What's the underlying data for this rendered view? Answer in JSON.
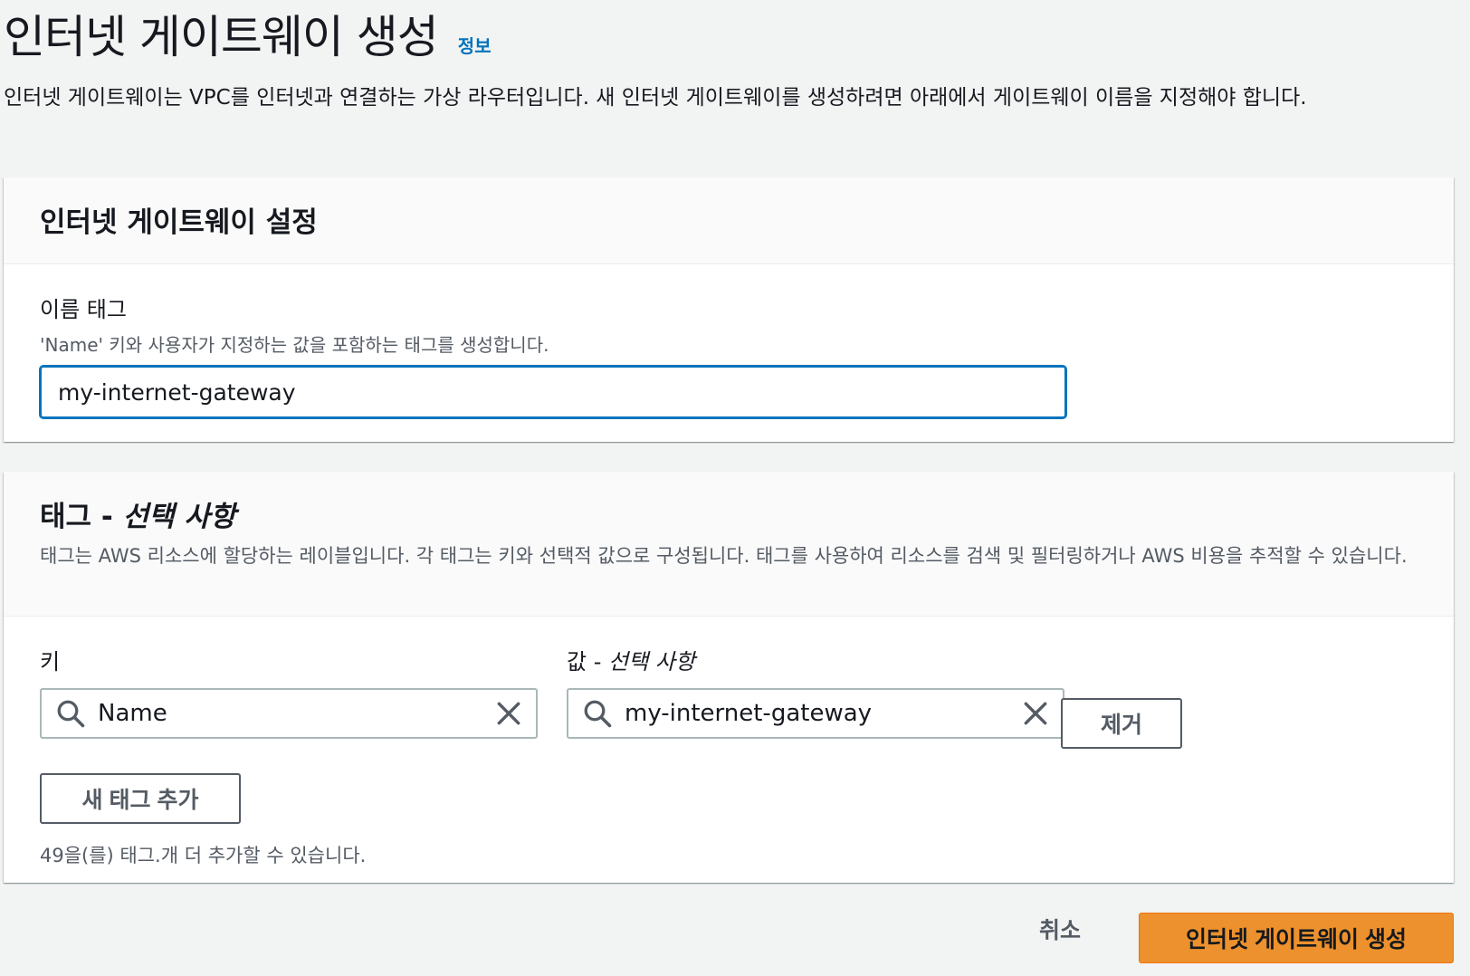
{
  "header": {
    "title": "인터넷 게이트웨이 생성",
    "info_link": "정보",
    "description": "인터넷 게이트웨이는 VPC를 인터넷과 연결하는 가상 라우터입니다. 새 인터넷 게이트웨이를 생성하려면 아래에서 게이트웨이 이름을 지정해야 합니다."
  },
  "settings": {
    "title": "인터넷 게이트웨이 설정",
    "name_tag": {
      "label": "이름 태그",
      "hint": "'Name' 키와 사용자가 지정하는 값을 포함하는 태그를 생성합니다.",
      "value": "my-internet-gateway"
    }
  },
  "tags": {
    "title_main": "태그 - ",
    "title_optional": "선택 사항",
    "description": "태그는 AWS 리소스에 할당하는 레이블입니다. 각 태그는 키와 선택적 값으로 구성됩니다. 태그를 사용하여 리소스를 검색 및 필터링하거나 AWS 비용을 추적할 수 있습니다.",
    "key_label": "키",
    "value_label_main": "값 - ",
    "value_label_optional": "선택 사항",
    "rows": [
      {
        "key": "Name",
        "value": "my-internet-gateway"
      }
    ],
    "remove_label": "제거",
    "add_label": "새 태그 추가",
    "limit_text": "49을(를) 태그.개 더 추가할 수 있습니다.",
    "icons": {
      "search": "search-icon",
      "clear": "close-icon"
    }
  },
  "footer": {
    "cancel_label": "취소",
    "create_label": "인터넷 게이트웨이 생성"
  },
  "colors": {
    "primary_button": "#ec912d",
    "link": "#0073bb",
    "focus_border": "#0073bb"
  }
}
